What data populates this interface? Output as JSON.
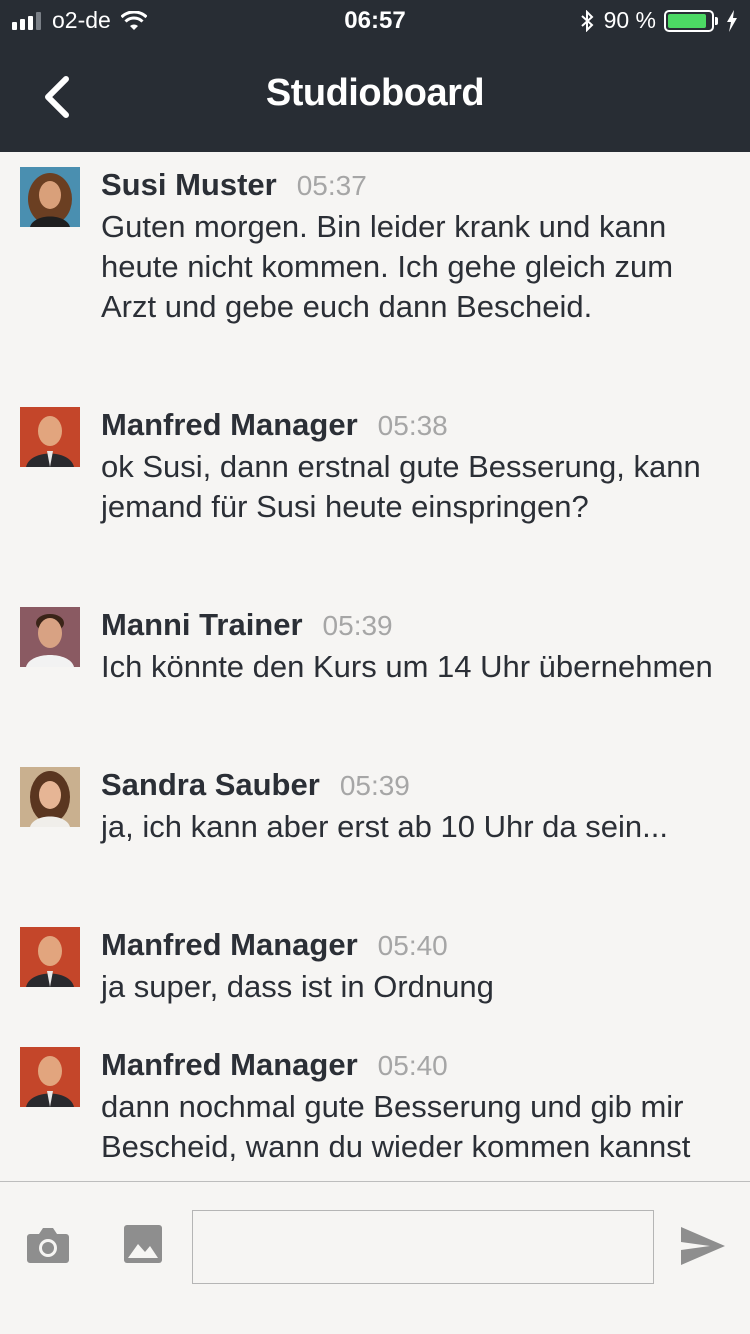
{
  "status_bar": {
    "carrier": "o2-de",
    "time": "06:57",
    "battery": "90 %"
  },
  "header": {
    "title": "Studioboard",
    "icons": [
      "chevron-left-icon"
    ]
  },
  "messages": [
    {
      "name": "Susi Muster",
      "time": "05:37",
      "text": "Guten morgen. Bin leider krank und kann heute nicht kommen. Ich gehe gleich zum Arzt und gebe euch dann Bescheid."
    },
    {
      "name": "Manfred Manager",
      "time": "05:38",
      "text": "ok Susi, dann erstnal gute Besserung, kann jemand für Susi heute einspringen?"
    },
    {
      "name": "Manni Trainer",
      "time": "05:39",
      "text": "Ich könnte den Kurs um 14 Uhr übernehmen"
    },
    {
      "name": "Sandra Sauber",
      "time": "05:39",
      "text": "ja, ich kann aber erst ab 10 Uhr da sein..."
    },
    {
      "name": "Manfred Manager",
      "time": "05:40",
      "text": "ja super, dass ist in Ordnung"
    },
    {
      "name": "Manfred Manager",
      "time": "05:40",
      "text": "dann nochmal gute Besserung und gib mir Bescheid, wann du wieder kommen kannst"
    }
  ],
  "composer": {
    "value": "",
    "icons": [
      "camera-icon",
      "image-icon",
      "send-icon"
    ]
  },
  "colors": {
    "header_bg": "#282d34",
    "page_bg": "#f6f5f3",
    "battery_fill": "#4cd964",
    "timestamp": "#a6a6a6",
    "icon_gray": "#8e8e8e"
  }
}
